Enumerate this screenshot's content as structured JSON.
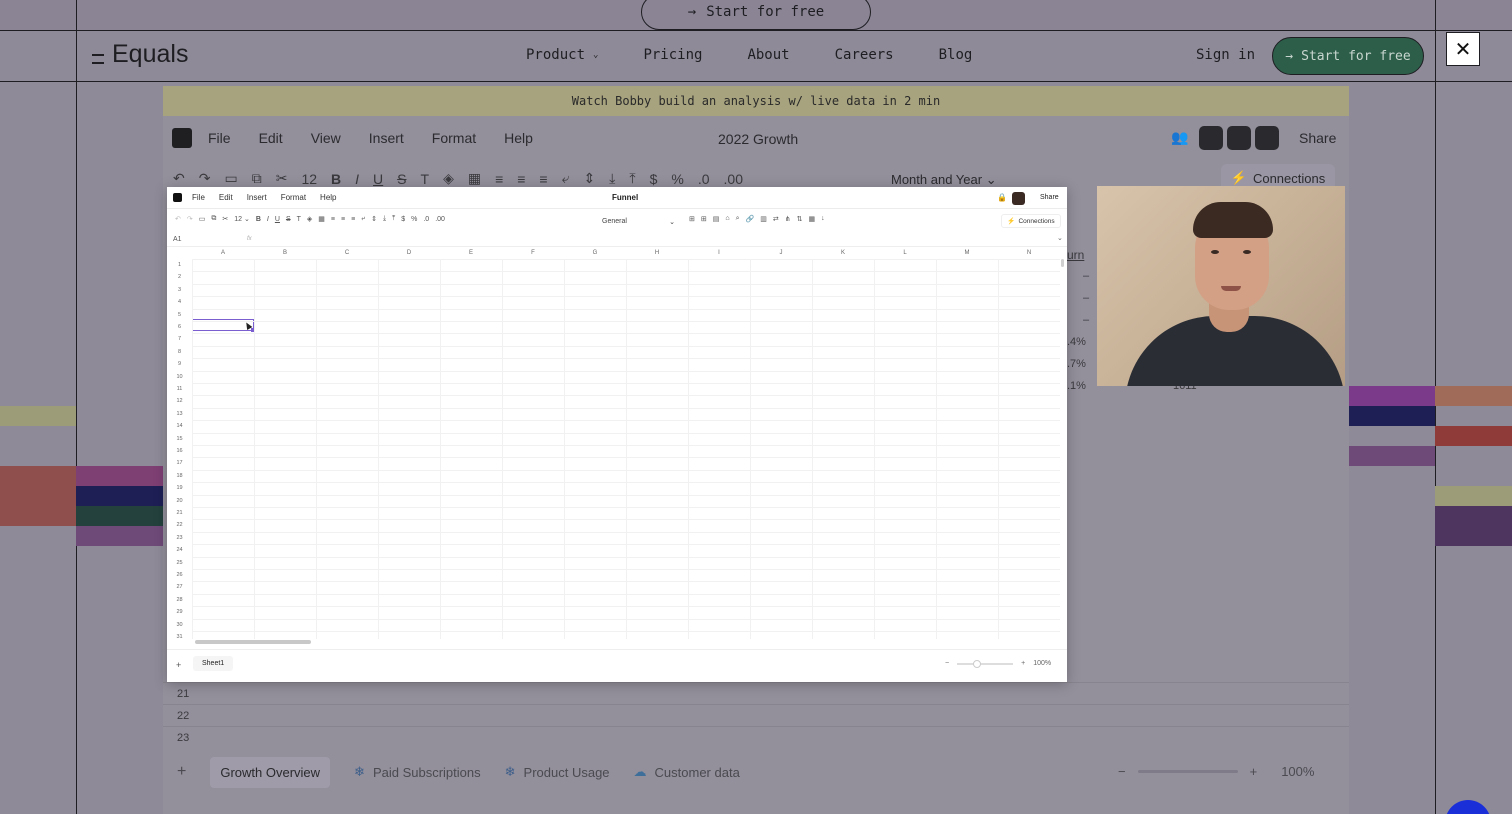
{
  "site": {
    "top_cta": "Start for free",
    "logo": "Equals",
    "nav": [
      "Product",
      "Pricing",
      "About",
      "Careers",
      "Blog"
    ],
    "sign_in": "Sign in",
    "nav_cta": "Start for free",
    "close_icon": "close-icon"
  },
  "background_app": {
    "banner": "Watch Bobby build an analysis w/ live data in 2 min",
    "menu": [
      "File",
      "Edit",
      "View",
      "Insert",
      "Format",
      "Help"
    ],
    "title": "2022 Growth",
    "share": "Share",
    "font_size": "12",
    "date_group": "Month and Year",
    "connections": "Connections",
    "partial_values": [
      "urn",
      "–",
      "–",
      "–",
      ".4%",
      ".7%",
      ".1%"
    ],
    "partial_extra": "1611",
    "rows": [
      "21",
      "22",
      "23"
    ],
    "tabs": [
      "Growth Overview",
      "Paid Subscriptions",
      "Product Usage",
      "Customer data"
    ],
    "zoom": "100%"
  },
  "video_app": {
    "menu": [
      "File",
      "Edit",
      "Insert",
      "Format",
      "Help"
    ],
    "title": "Funnel",
    "share": "Share",
    "font_size": "12",
    "number_format": "General",
    "connections": "Connections",
    "cell_ref": "A1",
    "fx": "fx",
    "columns": [
      "A",
      "B",
      "C",
      "D",
      "E",
      "F",
      "G",
      "H",
      "I",
      "J",
      "K",
      "L",
      "M",
      "N"
    ],
    "rows": [
      "1",
      "2",
      "3",
      "4",
      "5",
      "6",
      "7",
      "8",
      "9",
      "10",
      "11",
      "12",
      "13",
      "14",
      "15",
      "16",
      "17",
      "18",
      "19",
      "20",
      "21",
      "22",
      "23",
      "24",
      "25",
      "26",
      "27",
      "28",
      "29",
      "30",
      "31"
    ],
    "sheet_tab": "Sheet1",
    "zoom": "100%"
  },
  "colors": {
    "accent_green": "#2c5e4a",
    "selection": "#7b5fd0",
    "banner": "#a7a37e"
  }
}
